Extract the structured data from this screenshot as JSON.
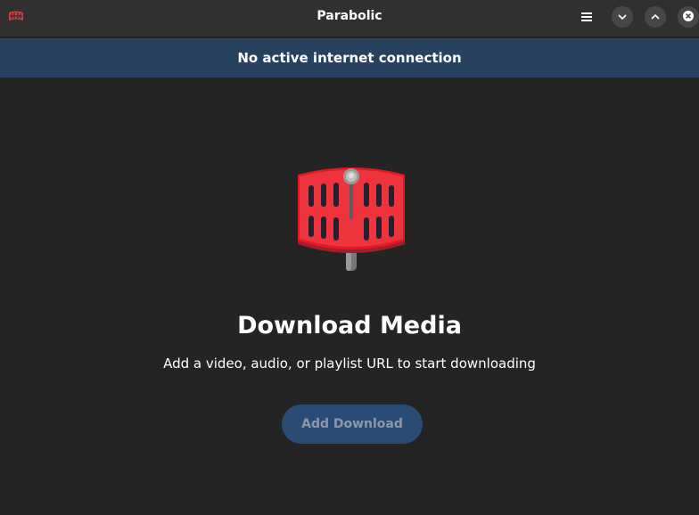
{
  "window": {
    "title": "Parabolic"
  },
  "header": {
    "app_icon": "parabolic-app-icon",
    "menu_icon": "hamburger-menu-icon",
    "minimize_icon": "chevron-down-icon",
    "maximize_icon": "chevron-up-icon",
    "close_icon": "close-icon"
  },
  "banner": {
    "title": "No active internet connection"
  },
  "status_page": {
    "icon": "parabolic-logo-icon",
    "title": "Download Media",
    "description": "Add a video, audio, or playlist URL to start downloading",
    "button_label": "Add Download"
  },
  "colors": {
    "background": "#242424",
    "headerbar": "#303030",
    "banner": "#27415e",
    "button": "#2a4b73",
    "logo_red": "#e83a3a"
  }
}
